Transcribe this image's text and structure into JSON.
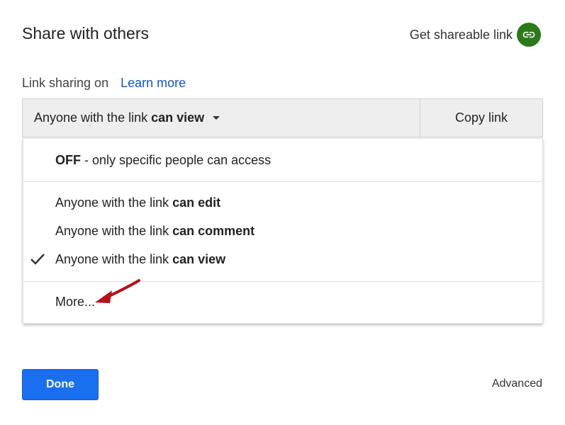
{
  "dialog": {
    "title": "Share with others",
    "get_link_label": "Get shareable link"
  },
  "sharing": {
    "status_label": "Link sharing on",
    "learn_more": "Learn more"
  },
  "selector": {
    "prefix": "Anyone with the link",
    "bold": "can view",
    "copy_link": "Copy link"
  },
  "menu": {
    "off": {
      "bold": "OFF",
      "rest": " - only specific people can access"
    },
    "options": [
      {
        "prefix": "Anyone with the link ",
        "bold": "can edit",
        "checked": false
      },
      {
        "prefix": "Anyone with the link ",
        "bold": "can comment",
        "checked": false
      },
      {
        "prefix": "Anyone with the link ",
        "bold": "can view",
        "checked": true
      }
    ],
    "more": "More..."
  },
  "footer": {
    "done": "Done",
    "advanced": "Advanced"
  },
  "colors": {
    "accent_blue": "#1a6ff0",
    "link_blue": "#1155cc",
    "link_icon_green": "#2b7a1a",
    "annotation_arrow": "#b5121b"
  },
  "icons": {
    "link": "link-icon",
    "check": "check-icon",
    "caret": "caret-down-icon",
    "annotation": "annotation-arrow"
  }
}
